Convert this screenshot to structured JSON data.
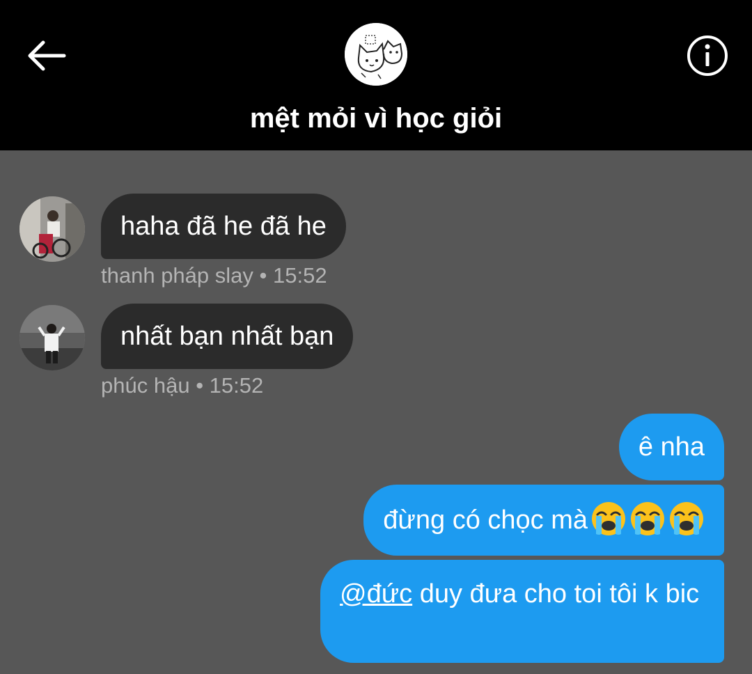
{
  "header": {
    "title": "mệt mỏi vì học giỏi",
    "back_icon": "arrow-left-icon",
    "info_icon": "info-circle-icon"
  },
  "messages_in": [
    {
      "text": "haha đã he đã he",
      "sender": "thanh pháp slay",
      "time": "15:52"
    },
    {
      "text": "nhất bạn nhất bạn",
      "sender": "phúc hậu",
      "time": "15:52"
    }
  ],
  "messages_out": [
    {
      "text": "ê nha"
    },
    {
      "text": "đừng có chọc mà",
      "emoji": [
        "loudly-crying-face",
        "loudly-crying-face",
        "loudly-crying-face"
      ]
    },
    {
      "mention": "@đức",
      "text": " duy đưa cho toi tôi k bic"
    }
  ],
  "meta_separator": "•",
  "colors": {
    "header_bg": "#000000",
    "chat_bg": "#575757",
    "incoming_bubble": "#2b2b2b",
    "outgoing_bubble": "#1d9bf0",
    "meta_text": "#b4b4b4"
  }
}
